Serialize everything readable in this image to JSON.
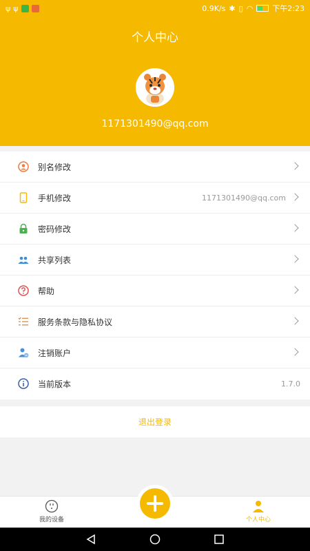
{
  "status_bar": {
    "speed": "0.9K/s",
    "time": "下午2:23"
  },
  "header": {
    "title": "个人中心",
    "email": "1171301490@qq.com"
  },
  "menu": [
    {
      "label": "别名修改",
      "value": "",
      "icon": "person-circle-icon",
      "color": "#f07b3f"
    },
    {
      "label": "手机修改",
      "value": "1171301490@qq.com",
      "icon": "phone-icon",
      "color": "#f5b900"
    },
    {
      "label": "密码修改",
      "value": "",
      "icon": "lock-icon",
      "color": "#4caf50"
    },
    {
      "label": "共享列表",
      "value": "",
      "icon": "people-icon",
      "color": "#3b8fd8"
    },
    {
      "label": "帮助",
      "value": "",
      "icon": "question-icon",
      "color": "#e05050"
    },
    {
      "label": "服务条款与隐私协议",
      "value": "",
      "icon": "list-icon",
      "color": "#d0813a"
    },
    {
      "label": "注销账户",
      "value": "",
      "icon": "user-remove-icon",
      "color": "#4a90d9"
    },
    {
      "label": "当前版本",
      "value": "1.7.0",
      "icon": "info-icon",
      "color": "#3a5fa8"
    }
  ],
  "logout_label": "退出登录",
  "bottom_nav": {
    "devices_label": "我的设备",
    "profile_label": "个人中心"
  },
  "colors": {
    "brand": "#f5b900"
  }
}
